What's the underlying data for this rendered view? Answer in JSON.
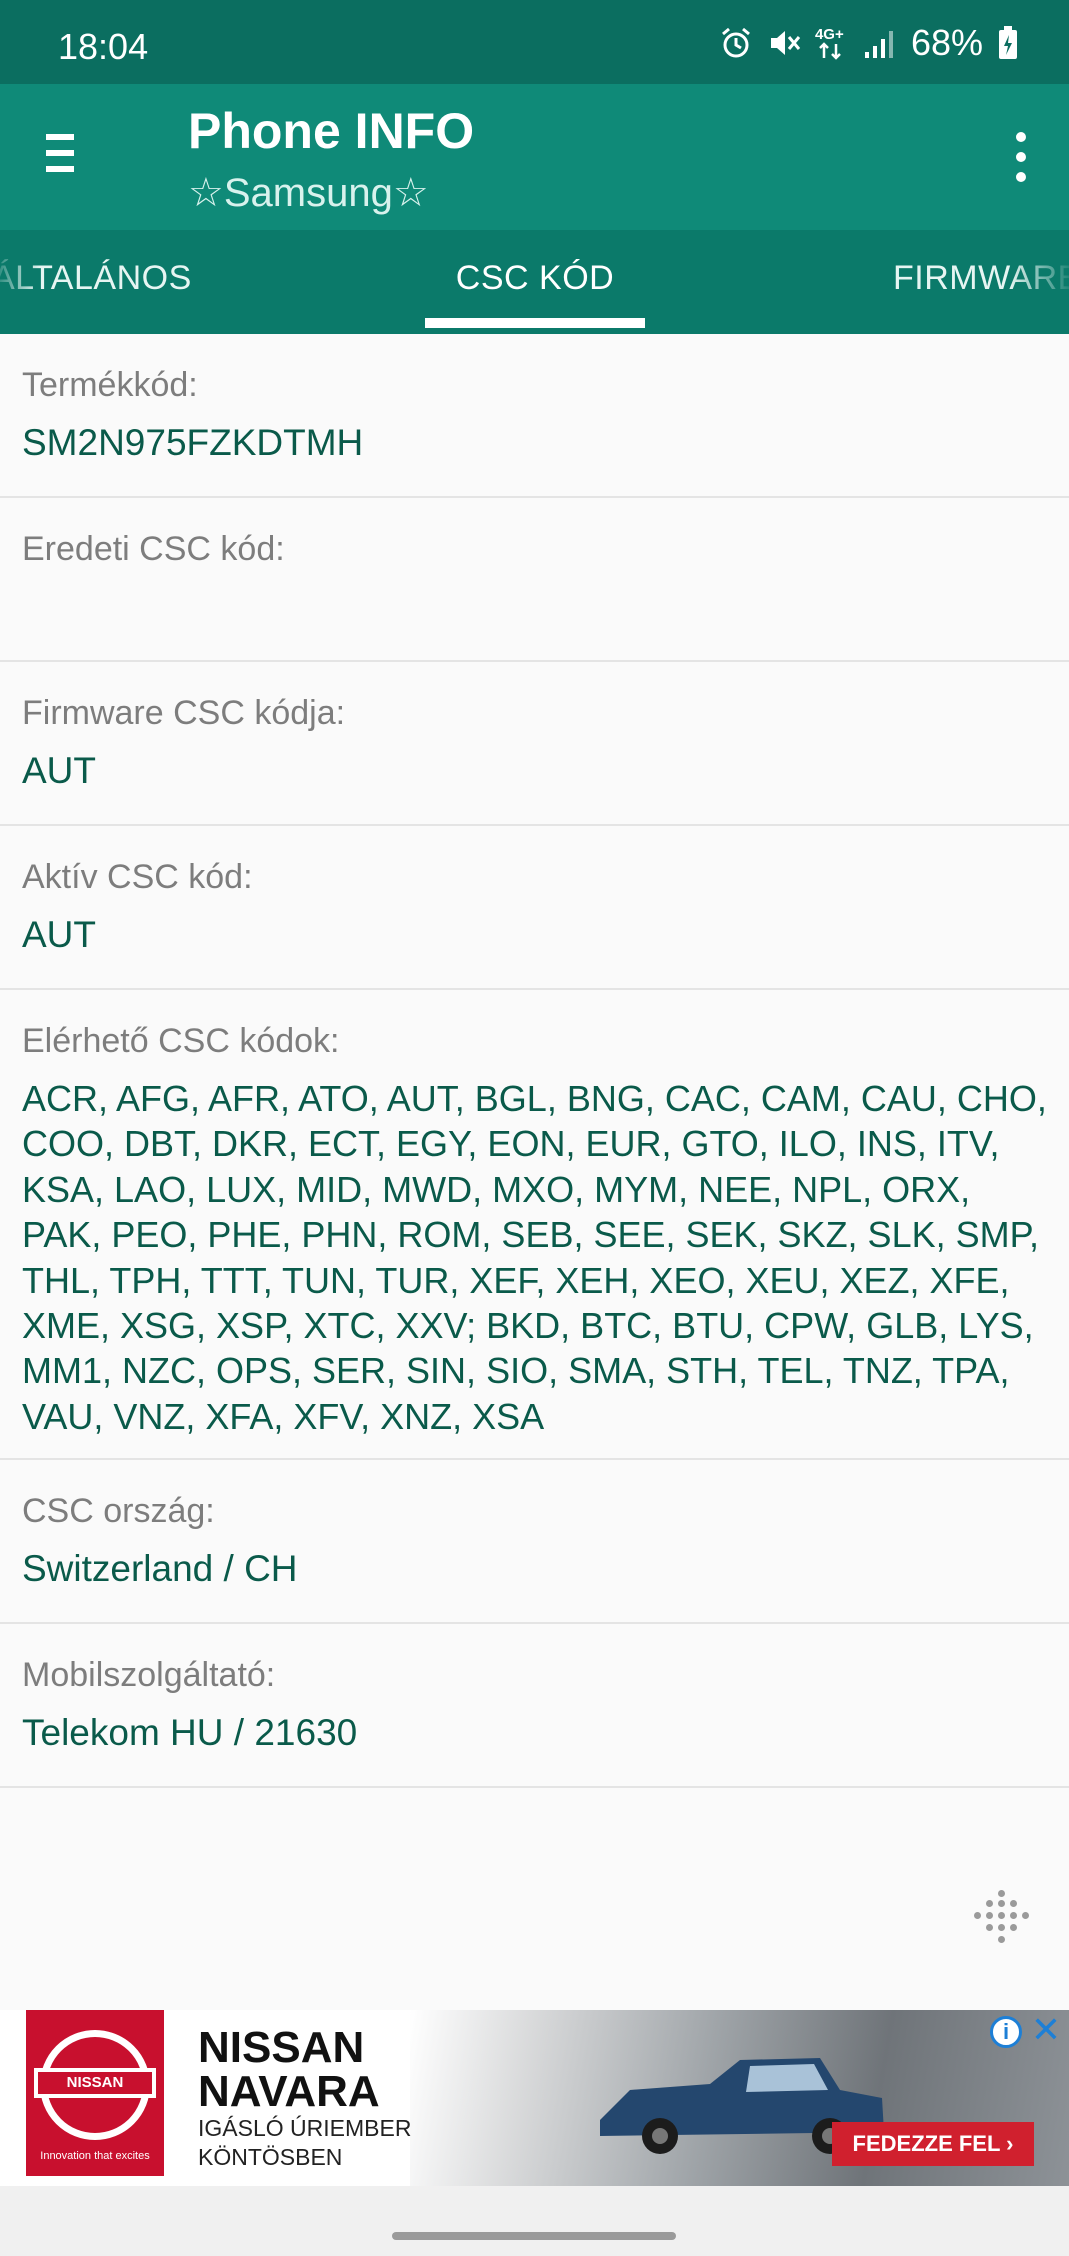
{
  "status_bar": {
    "time": "18:04",
    "network": "4G+",
    "battery": "68%",
    "icons": [
      "alarm-icon",
      "mute-icon",
      "data-icon",
      "signal-icon",
      "battery-icon"
    ]
  },
  "app_bar": {
    "title": "Phone INFO",
    "subtitle": "☆Samsung☆",
    "icons": [
      "menu-icon",
      "overflow-menu-icon"
    ]
  },
  "tabs": [
    {
      "label": "ÁLTALÁNOS",
      "active": false
    },
    {
      "label": "CSC KÓD",
      "active": true
    },
    {
      "label": "FIRMWARE",
      "active": false
    }
  ],
  "rows": [
    {
      "label": "Termékkód:",
      "value": "SM2N975FZKDTMH"
    },
    {
      "label": "Eredeti CSC kód:",
      "value": ""
    },
    {
      "label": "Firmware CSC kódja:",
      "value": "AUT"
    },
    {
      "label": "Aktív CSC kód:",
      "value": "AUT"
    },
    {
      "label": "Elérhető CSC kódok:",
      "value": "ACR, AFG, AFR, ATO, AUT, BGL, BNG, CAC, CAM, CAU, CHO, COO, DBT, DKR, ECT, EGY, EON, EUR, GTO, ILO, INS, ITV, KSA, LAO, LUX, MID, MWD, MXO, MYM, NEE, NPL, ORX, PAK, PEO, PHE, PHN, ROM, SEB, SEE, SEK, SKZ, SLK, SMP, THL, TPH, TTT, TUN, TUR, XEF, XEH, XEO, XEU, XEZ, XFE, XME, XSG, XSP, XTC, XXV; BKD, BTC, BTU, CPW, GLB, LYS, MM1, NZC, OPS, SER, SIN, SIO, SMA, STH, TEL, TNZ, TPA, VAU, VNZ, XFA, XFV, XNZ, XSA"
    },
    {
      "label": "CSC ország:",
      "value": "Switzerland / CH"
    },
    {
      "label": "Mobilszolgáltató:",
      "value": "Telekom HU / 21630"
    }
  ],
  "ad": {
    "logo_text": "NISSAN",
    "logo_tagline": "Innovation that excites",
    "brand_line1": "NISSAN",
    "brand_line2": "NAVARA",
    "tag_line1": "IGÁSLÓ ÚRIEMBER",
    "tag_line2": "KÖNTÖSBEN",
    "cta": "FEDEZZE FEL ›",
    "info_icon": "i",
    "close_icon": "✕",
    "colors": {
      "brand": "#c8102e",
      "cta": "#d0202e",
      "adchoices": "#1d7fd6"
    }
  },
  "colors": {
    "status_bar": "#0b6e60",
    "app_bar": "#0f8a78",
    "tab_bar": "#0b7a6a",
    "value_text": "#0a5a4a",
    "label_text": "#7d7d7d"
  }
}
